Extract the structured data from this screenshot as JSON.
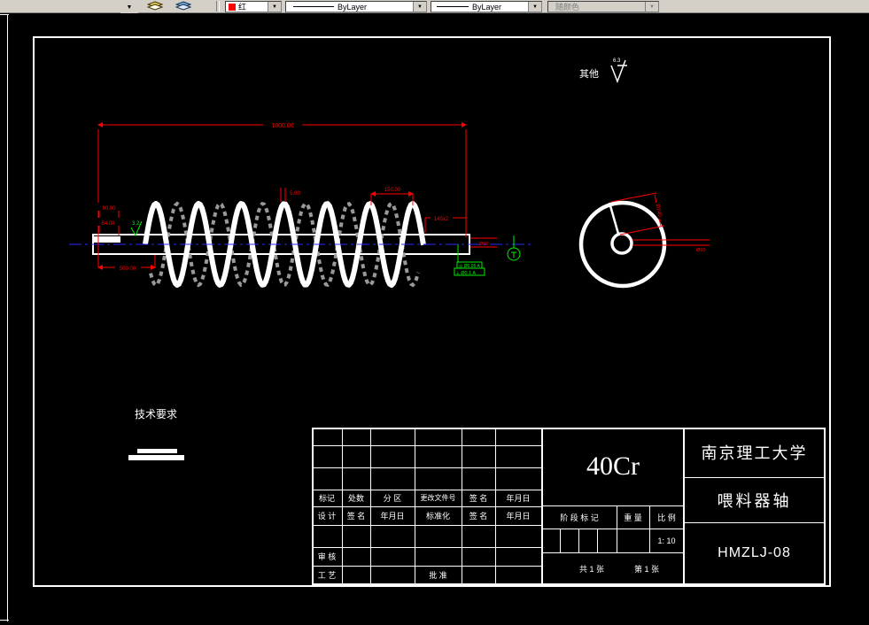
{
  "toolbar": {
    "color_label": "红",
    "color_value": "#ff0000",
    "linetype_label": "ByLayer",
    "lineweight_label": "ByLayer",
    "plotstyle_label": "随颜色",
    "dropdown_glyph": "▼"
  },
  "notes": {
    "other_label": "其他",
    "other_roughness": "6.3",
    "tech_req": "技术要求",
    "surface_roughness": "3.2"
  },
  "dimensions": {
    "overall_length": "1800.00",
    "left_outer": "90.00",
    "left_inner": "64.00",
    "left_segment": "500.00",
    "flight_thickness": "5.00",
    "pitch": "150.00",
    "chamfer": "145x2",
    "shaft_dia": "Ø60",
    "end_outer_dia": "Ø240",
    "end_shaft_dia": "Ø60",
    "tol_frame_top": "◎ Ø0.05 A",
    "tol_frame_bottom": "⟂ Ø0.1 A"
  },
  "titleblock": {
    "material": "40Cr",
    "company": "南京理工大学",
    "part_name": "喂料器轴",
    "drawing_no": "HMZLJ-08",
    "label_stage": "阶 段 标 记",
    "label_weight": "重 量",
    "label_scale": "比 例",
    "scale_value": "1: 10",
    "sheet_total": "共 1 张",
    "sheet_no": "第 1 张",
    "row_mark": [
      "标记",
      "处数",
      "分 区",
      "更改文件号",
      "签 名",
      "年月日"
    ],
    "row_design": [
      "设 计",
      "签 名",
      "年月日",
      "标准化",
      "签 名",
      "年月日"
    ],
    "label_review": "审 核",
    "label_process": "工 艺",
    "label_approve": "批 准"
  }
}
